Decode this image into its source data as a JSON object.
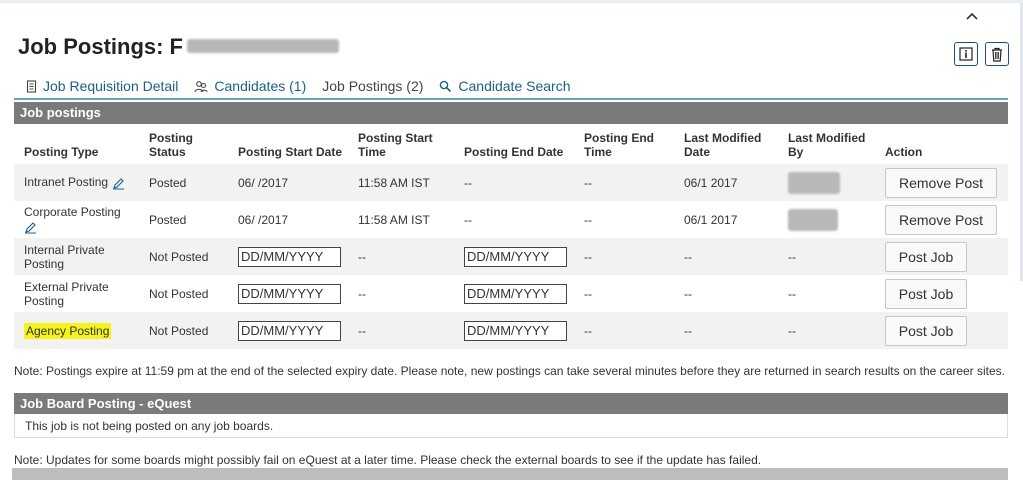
{
  "page": {
    "title": "Job Postings: F"
  },
  "tabs": [
    {
      "label": "Job Requisition Detail",
      "icon": "document-icon"
    },
    {
      "label": "Candidates (1)",
      "icon": "people-icon"
    },
    {
      "label": "Job Postings (2)",
      "icon": ""
    },
    {
      "label": "Candidate Search",
      "icon": "search-icon"
    }
  ],
  "job_postings": {
    "section_title": "Job postings",
    "columns": [
      "Posting Type",
      "Posting Status",
      "Posting Start Date",
      "Posting Start Time",
      "Posting End Date",
      "Posting End Time",
      "Last Modified Date",
      "Last Modified By",
      "Action"
    ],
    "date_placeholder": "DD/MM/YYYY",
    "rows": [
      {
        "type": "Intranet Posting",
        "status": "Posted",
        "start_date": "06/  /2017",
        "start_time": "11:58 AM IST",
        "end_date": "--",
        "end_time": "--",
        "modified_date": "06/1   2017",
        "modified_by": "",
        "action": "Remove Post"
      },
      {
        "type": "Corporate Posting",
        "status": "Posted",
        "start_date": "06/  /2017",
        "start_time": "11:58 AM IST",
        "end_date": "--",
        "end_time": "--",
        "modified_date": "06/1   2017",
        "modified_by": "",
        "action": "Remove Post"
      },
      {
        "type": "Internal Private Posting",
        "status": "Not Posted",
        "start_time": "--",
        "end_time": "--",
        "modified_date": "--",
        "modified_by": "--",
        "action": "Post Job"
      },
      {
        "type": "External Private Posting",
        "status": "Not Posted",
        "start_time": "--",
        "end_time": "--",
        "modified_date": "--",
        "modified_by": "--",
        "action": "Post Job"
      },
      {
        "type": "Agency Posting",
        "status": "Not Posted",
        "start_time": "--",
        "end_time": "--",
        "modified_date": "--",
        "modified_by": "--",
        "action": "Post Job"
      }
    ],
    "note": "Note: Postings expire at 11:59 pm at the end of the selected expiry date. Please note, new postings can take several minutes before they are returned in search results on the career sites."
  },
  "equest": {
    "section_title": "Job Board Posting - eQuest",
    "message": "This job is not being posted on any job boards.",
    "note": "Note: Updates for some boards might possibly fail on eQuest at a later time. Please check the external boards to see if the update has failed."
  },
  "colors": {
    "section_bar": "#7a7a7a",
    "link": "#1c5f86",
    "highlight": "#f4f41c",
    "tab_underline": "#6aa0c2"
  }
}
